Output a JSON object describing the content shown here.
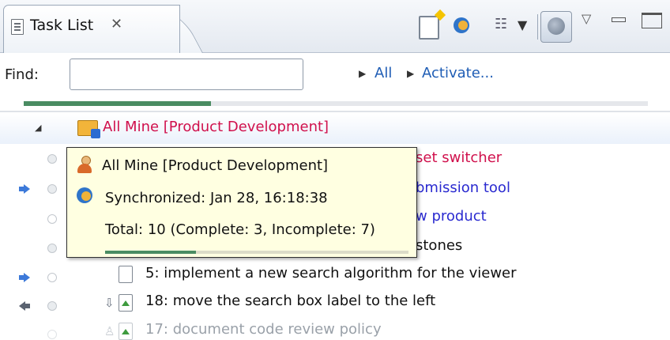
{
  "view": {
    "tab_title": "Task List",
    "tab_close_glyph": "✕"
  },
  "toolbar": {
    "icons": [
      "new-task-icon",
      "synchronize-icon",
      "presentation-icon",
      "dropdown-arrow-icon",
      "focus-on-workweek-icon",
      "view-menu-icon",
      "minimize-icon",
      "maximize-icon"
    ]
  },
  "find": {
    "label": "Find:",
    "value": "",
    "placeholder": ""
  },
  "filters": {
    "all": "All",
    "activate": "Activate..."
  },
  "progress": {
    "complete_fraction": 0.3
  },
  "colors": {
    "accent_link": "#1f5db5",
    "category_red": "#d0104c",
    "incoming_blue": "#2a2ad0",
    "progress_green": "#4a8c62",
    "tooltip_bg": "#ffffe1"
  },
  "tree": {
    "category_label": "All Mine  [Product Development]",
    "rows": [
      {
        "text": "set switcher",
        "color": "red"
      },
      {
        "text": "bmission tool",
        "color": "blue"
      },
      {
        "text": "w product",
        "color": "blue"
      },
      {
        "text": "stones",
        "color": "black"
      },
      {
        "text": "5: implement a new search algorithm for the viewer",
        "color": "black"
      },
      {
        "text": "18: move the search box label to the left",
        "color": "black"
      },
      {
        "text": "17: document code review policy",
        "color": "gray"
      }
    ]
  },
  "tooltip": {
    "title": "All Mine  [Product Development]",
    "synchronized": "Synchronized: Jan 28, 16:18:38",
    "total": "Total: 10 (Complete: 3, Incomplete: 7)",
    "complete_fraction": 0.3
  }
}
